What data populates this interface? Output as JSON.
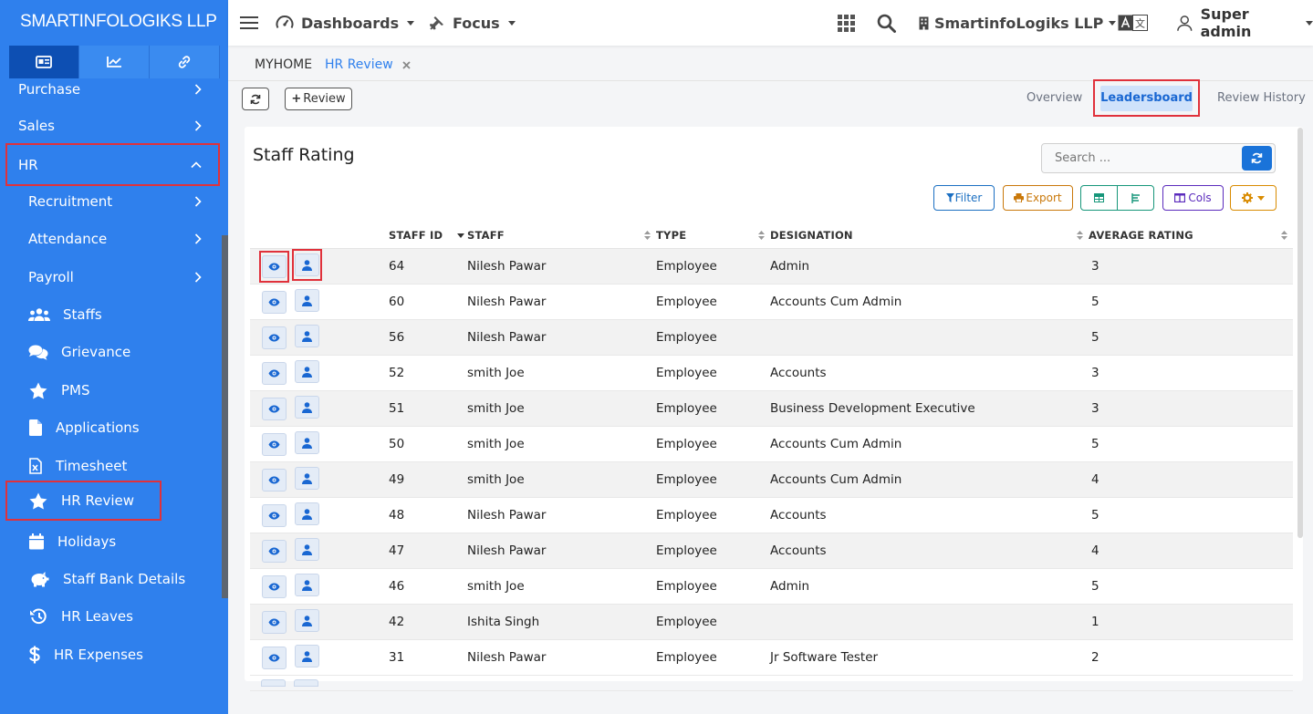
{
  "brand": "SMARTINFOLOGIKS LLP",
  "topbar": {
    "dashboards": "Dashboards",
    "focus": "Focus",
    "company": "SmartinfoLogiks LLP",
    "user": "Super admin"
  },
  "sidebar": {
    "items": [
      {
        "label": "Purchase",
        "icon": "chevron-right-icon"
      },
      {
        "label": "Sales",
        "icon": "chevron-right-icon"
      },
      {
        "label": "HR",
        "icon": "chevron-up-icon"
      },
      {
        "label": "Recruitment",
        "icon": "chevron-right-icon"
      },
      {
        "label": "Attendance",
        "icon": "chevron-right-icon"
      },
      {
        "label": "Payroll",
        "icon": "chevron-right-icon"
      },
      {
        "label": "Staffs",
        "icon": "users-icon"
      },
      {
        "label": "Grievance",
        "icon": "comments-icon"
      },
      {
        "label": "PMS",
        "icon": "star-icon"
      },
      {
        "label": "Applications",
        "icon": "file-icon"
      },
      {
        "label": "Timesheet",
        "icon": "excel-file-icon"
      },
      {
        "label": "HR Review",
        "icon": "star-icon"
      },
      {
        "label": "Holidays",
        "icon": "calendar-icon"
      },
      {
        "label": "Staff Bank Details",
        "icon": "piggy-bank-icon"
      },
      {
        "label": "HR Leaves",
        "icon": "history-icon"
      },
      {
        "label": "HR Expenses",
        "icon": "dollar-icon"
      }
    ]
  },
  "breadcrumb": {
    "home": "MYHOME",
    "current": "HR Review"
  },
  "toolbar": {
    "add_review": "Review",
    "tabs": [
      "Overview",
      "Leadersboard",
      "Review History"
    ]
  },
  "card": {
    "title": "Staff Rating",
    "search_placeholder": "Search ...",
    "actions": {
      "filter": "Filter",
      "export": "Export",
      "cols": "Cols"
    }
  },
  "table": {
    "columns": [
      "STAFF ID",
      "STAFF",
      "TYPE",
      "DESIGNATION",
      "AVERAGE RATING"
    ],
    "rows": [
      {
        "id": "64",
        "staff": "Nilesh Pawar",
        "type": "Employee",
        "designation": "Admin",
        "rating": "3"
      },
      {
        "id": "60",
        "staff": "Nilesh Pawar",
        "type": "Employee",
        "designation": "Accounts Cum Admin",
        "rating": "5"
      },
      {
        "id": "56",
        "staff": "Nilesh Pawar",
        "type": "Employee",
        "designation": "",
        "rating": "5"
      },
      {
        "id": "52",
        "staff": "smith Joe",
        "type": "Employee",
        "designation": "Accounts",
        "rating": "3"
      },
      {
        "id": "51",
        "staff": "smith Joe",
        "type": "Employee",
        "designation": "Business Development Executive",
        "rating": "3"
      },
      {
        "id": "50",
        "staff": "smith Joe",
        "type": "Employee",
        "designation": "Accounts Cum Admin",
        "rating": "5"
      },
      {
        "id": "49",
        "staff": "smith Joe",
        "type": "Employee",
        "designation": "Accounts Cum Admin",
        "rating": "4"
      },
      {
        "id": "48",
        "staff": "Nilesh Pawar",
        "type": "Employee",
        "designation": "Accounts",
        "rating": "5"
      },
      {
        "id": "47",
        "staff": "Nilesh Pawar",
        "type": "Employee",
        "designation": "Accounts",
        "rating": "4"
      },
      {
        "id": "46",
        "staff": "smith Joe",
        "type": "Employee",
        "designation": "Admin",
        "rating": "5"
      },
      {
        "id": "42",
        "staff": "Ishita Singh",
        "type": "Employee",
        "designation": "",
        "rating": "1"
      },
      {
        "id": "31",
        "staff": "Nilesh Pawar",
        "type": "Employee",
        "designation": "Jr Software Tester",
        "rating": "2"
      }
    ]
  },
  "colors": {
    "primary": "#2f80ed",
    "highlight": "#e0313b",
    "filter": "#1b6fc2",
    "export": "#c9780a",
    "view": "#16967a",
    "cols": "#5b2bbd",
    "gear": "#d98b00"
  }
}
